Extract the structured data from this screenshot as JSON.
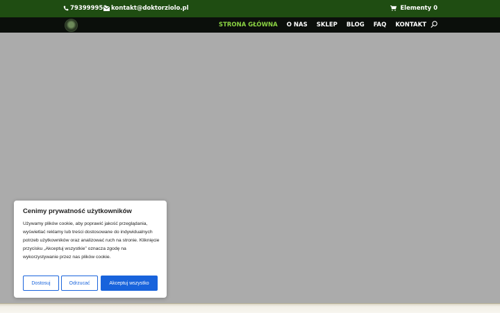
{
  "topbar": {
    "phone": "793999950",
    "email": "kontakt@doktorziolo.pl",
    "cart_label": "Elementy 0"
  },
  "nav": {
    "items": [
      {
        "label": "STRONA GŁÓWNA",
        "active": true
      },
      {
        "label": "O NAS"
      },
      {
        "label": "SKLEP"
      },
      {
        "label": "BLOG"
      },
      {
        "label": "FAQ"
      },
      {
        "label": "KONTAKT"
      }
    ],
    "search_icon": "search-icon"
  },
  "cookie_banner": {
    "title": "Cenimy prywatność użytkowników",
    "text": "Używamy plików cookie, aby poprawić jakość przeglądania, wyświetlać reklamy lub treści dostosowane do indywidualnych potrzeb użytkowników oraz analizować ruch na stronie. Kliknięcie przycisku „Akceptuj wszystkie” oznacza zgodę na wykorzystywanie przez nas plików cookie.",
    "buttons": {
      "customize": "Dostosuj",
      "reject": "Odrzucać",
      "accept": "Akceptuj wszystko"
    }
  },
  "colors": {
    "topbar_bg": "#1f4d12",
    "nav_bg": "#0b0f0b",
    "nav_active": "#8bd443",
    "accent_blue": "#1863dc",
    "hero_bg": "#ababab"
  }
}
